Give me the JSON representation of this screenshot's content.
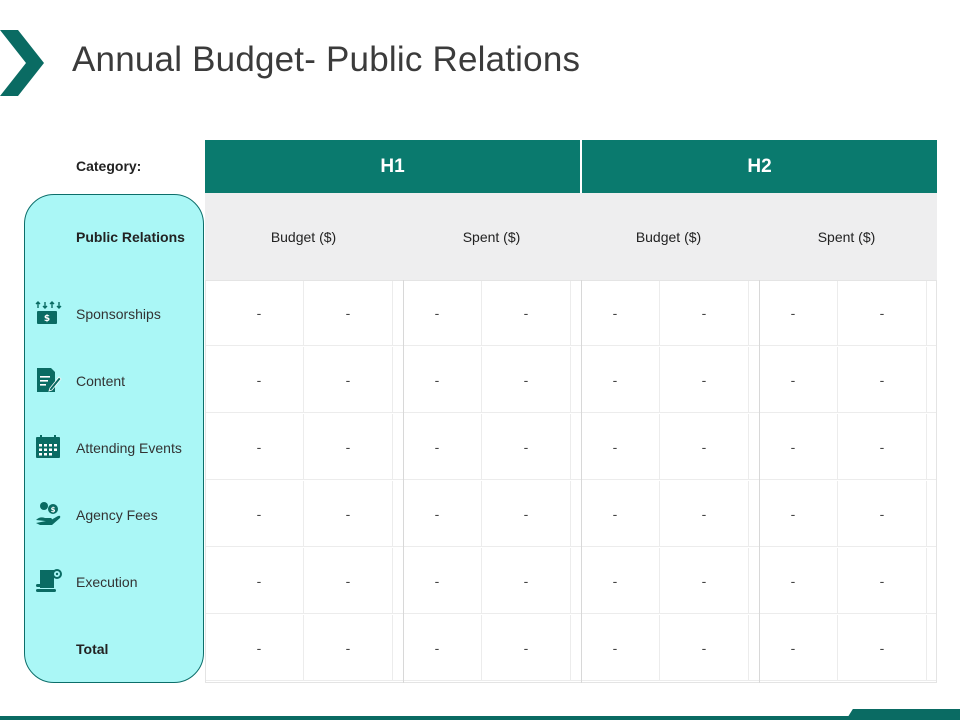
{
  "title": "Annual Budget- Public Relations",
  "category_label": "Category:",
  "header_row_label": "Public Relations",
  "halves": [
    {
      "label": "H1"
    },
    {
      "label": "H2"
    }
  ],
  "subheaders": [
    "Budget ($)",
    "Spent ($)",
    "Budget ($)",
    "Spent ($)"
  ],
  "rows": [
    {
      "label": "Sponsorships",
      "icon": "sponsorship-icon",
      "cells": [
        "-",
        "-",
        "-",
        "-",
        "-",
        "-",
        "-",
        "-"
      ]
    },
    {
      "label": "Content",
      "icon": "content-edit-icon",
      "cells": [
        "-",
        "-",
        "-",
        "-",
        "-",
        "-",
        "-",
        "-"
      ]
    },
    {
      "label": "Attending Events",
      "icon": "calendar-icon",
      "cells": [
        "-",
        "-",
        "-",
        "-",
        "-",
        "-",
        "-",
        "-"
      ]
    },
    {
      "label": "Agency Fees",
      "icon": "hand-coins-icon",
      "cells": [
        "-",
        "-",
        "-",
        "-",
        "-",
        "-",
        "-",
        "-"
      ]
    },
    {
      "label": "Execution",
      "icon": "document-gear-icon",
      "cells": [
        "-",
        "-",
        "-",
        "-",
        "-",
        "-",
        "-",
        "-"
      ]
    },
    {
      "label": "Total",
      "icon": "",
      "cells": [
        "-",
        "-",
        "-",
        "-",
        "-",
        "-",
        "-",
        "-"
      ]
    }
  ],
  "colors": {
    "accent": "#0a7a6e",
    "panel": "#aaf7f6",
    "subheader_bg": "#eeeeef"
  }
}
